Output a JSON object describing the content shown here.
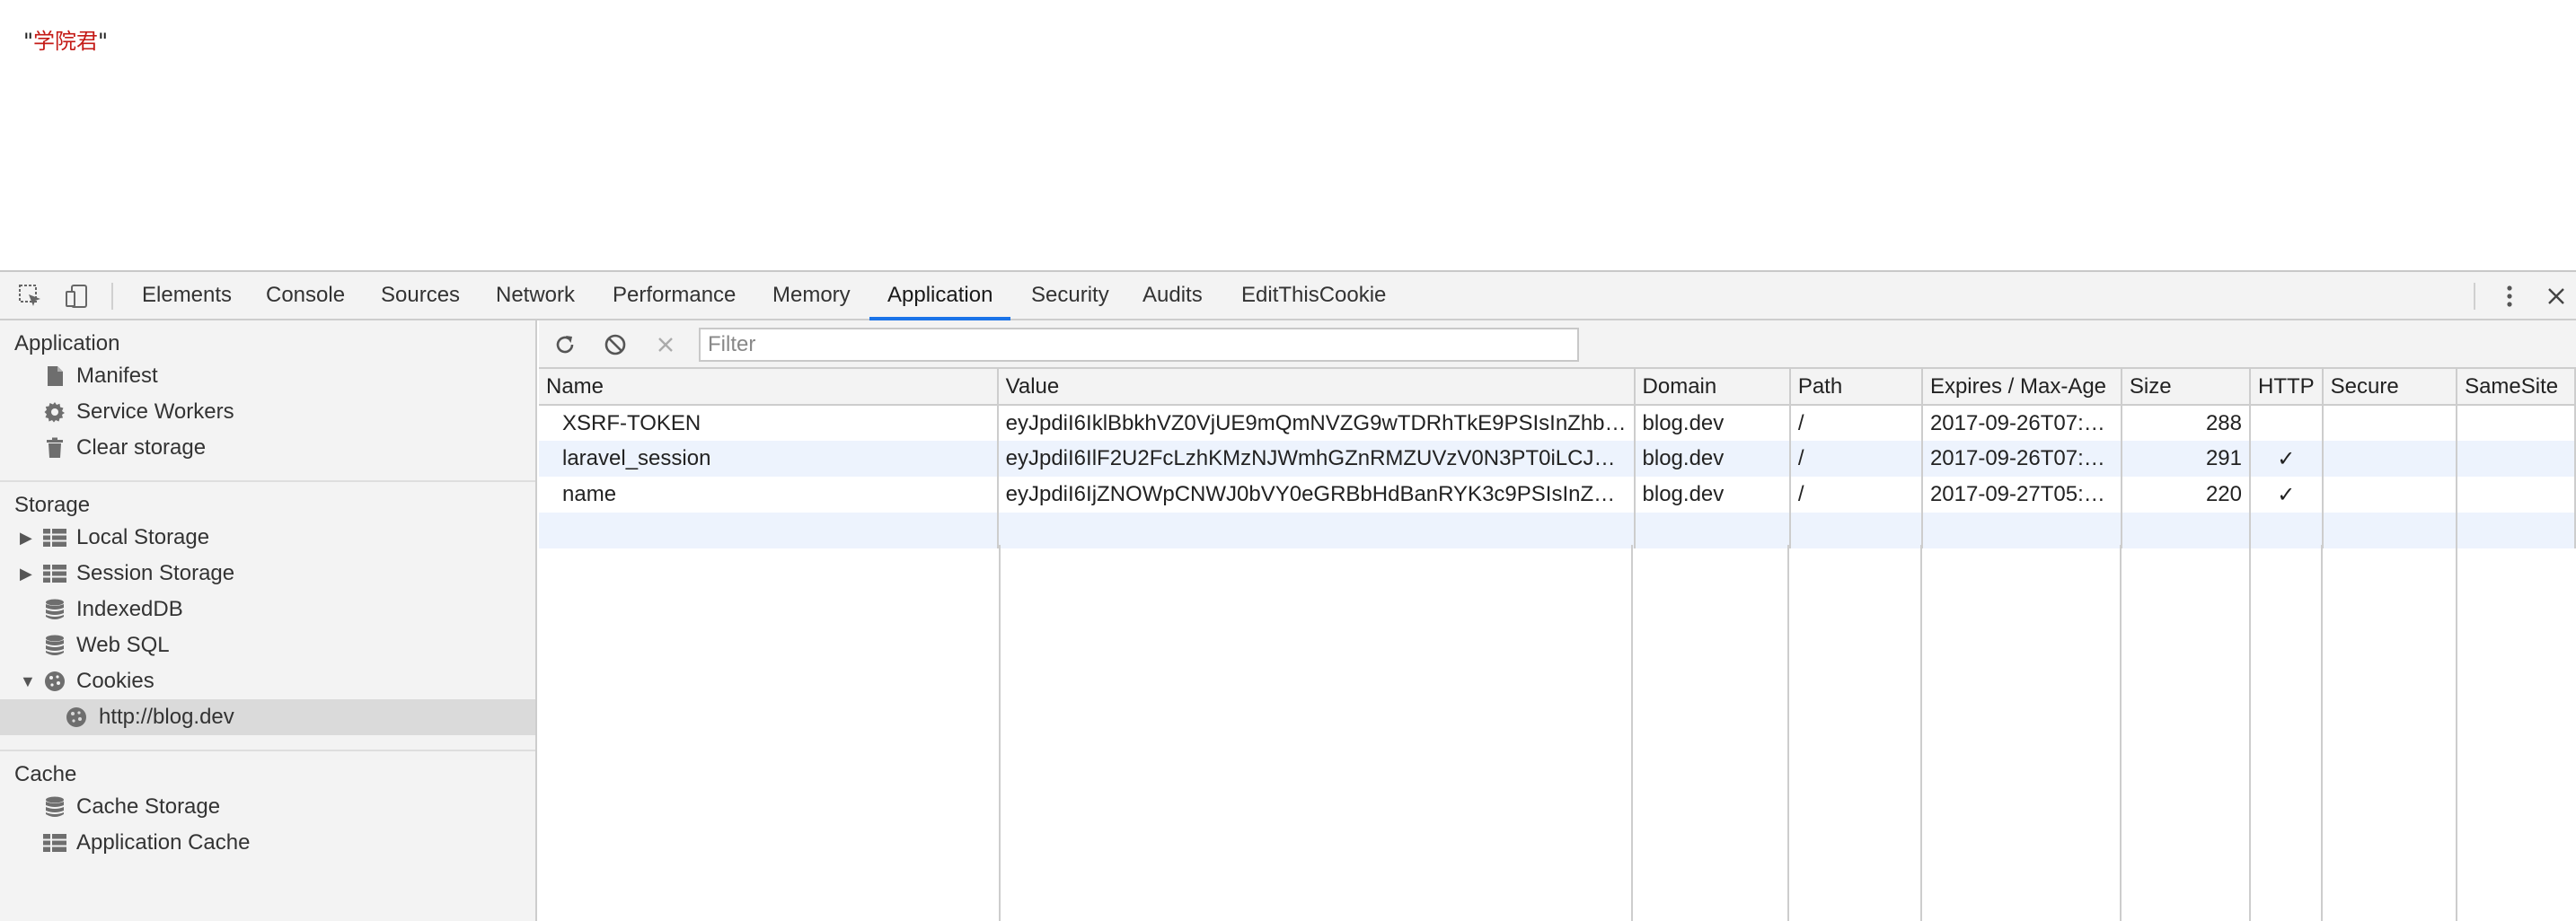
{
  "page": {
    "quote_open": "\"",
    "text": "学院君",
    "quote_close": "\""
  },
  "devtools": {
    "tabs": [
      "Elements",
      "Console",
      "Sources",
      "Network",
      "Performance",
      "Memory",
      "Application",
      "Security",
      "Audits",
      "EditThisCookie"
    ],
    "active_tab": "Application",
    "accent_color": "#1a73e8"
  },
  "sidebar": {
    "application": {
      "title": "Application",
      "items": [
        {
          "label": "Manifest",
          "icon": "file-icon"
        },
        {
          "label": "Service Workers",
          "icon": "gear-icon"
        },
        {
          "label": "Clear storage",
          "icon": "trash-icon"
        }
      ]
    },
    "storage": {
      "title": "Storage",
      "items": [
        {
          "label": "Local Storage",
          "icon": "grid-icon",
          "expandable": true,
          "expanded": false
        },
        {
          "label": "Session Storage",
          "icon": "grid-icon",
          "expandable": true,
          "expanded": false
        },
        {
          "label": "IndexedDB",
          "icon": "database-icon"
        },
        {
          "label": "Web SQL",
          "icon": "database-icon"
        },
        {
          "label": "Cookies",
          "icon": "cookie-icon",
          "expandable": true,
          "expanded": true
        },
        {
          "label": "http://blog.dev",
          "icon": "cookie-icon",
          "selected": true
        }
      ]
    },
    "cache": {
      "title": "Cache",
      "items": [
        {
          "label": "Cache Storage",
          "icon": "database-icon"
        },
        {
          "label": "Application Cache",
          "icon": "grid-icon"
        }
      ]
    }
  },
  "toolbar": {
    "filter_placeholder": "Filter",
    "filter_value": ""
  },
  "cookies": {
    "columns": [
      "Name",
      "Value",
      "Domain",
      "Path",
      "Expires / Max-Age",
      "Size",
      "HTTP",
      "Secure",
      "SameSite"
    ],
    "rows": [
      [
        "XSRF-TOKEN",
        "eyJpdiI6IklBbkhVZ0VjUE9mQmNVZG9wTDRhTkE9PSIsInZhb…",
        "blog.dev",
        "/",
        "2017-09-26T07:…",
        "288",
        "",
        "",
        ""
      ],
      [
        "laravel_session",
        "eyJpdiI6IlF2U2FcLzhKMzNJWmhGZnRMZUVzV0N3PT0iLCJ…",
        "blog.dev",
        "/",
        "2017-09-26T07:…",
        "291",
        "✓",
        "",
        ""
      ],
      [
        "name",
        "eyJpdiI6IjZNOWpCNWJ0bVY0eGRBbHdBanRYK3c9PSIsInZ…",
        "blog.dev",
        "/",
        "2017-09-27T05:…",
        "220",
        "✓",
        "",
        ""
      ]
    ]
  }
}
